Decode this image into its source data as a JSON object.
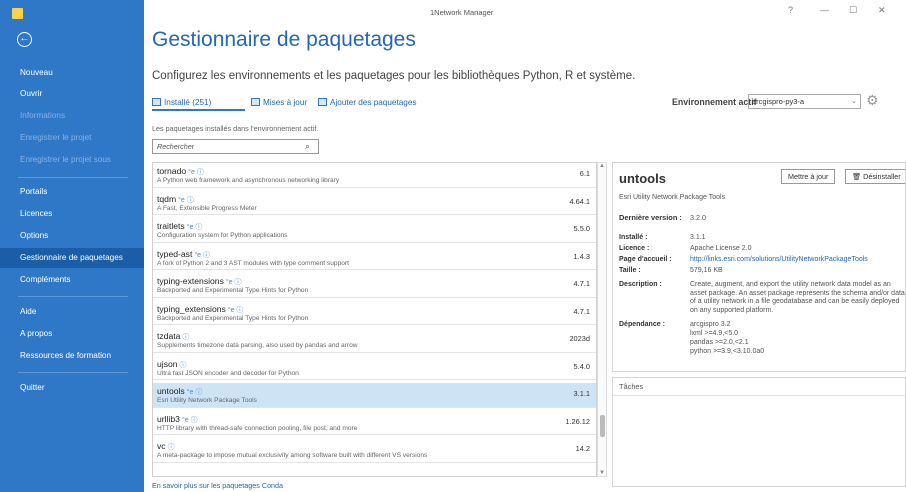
{
  "window": {
    "title": "1Network Manager",
    "controls": [
      "?",
      "—",
      "☐",
      "✕"
    ]
  },
  "sidebar": {
    "back_icon": "back-arrow-icon",
    "items": [
      {
        "label": "Nouveau",
        "state": "normal"
      },
      {
        "label": "Ouvrir",
        "state": "normal"
      },
      {
        "label": "Informations",
        "state": "disabled"
      },
      {
        "label": "Enregistrer le projet",
        "state": "disabled"
      },
      {
        "label": "Enregistrer le projet sous",
        "state": "disabled"
      },
      {
        "label": "Portails",
        "state": "normal"
      },
      {
        "label": "Licences",
        "state": "normal"
      },
      {
        "label": "Options",
        "state": "normal"
      },
      {
        "label": "Gestionnaire de paquetages",
        "state": "active"
      },
      {
        "label": "Compléments",
        "state": "normal"
      },
      {
        "label": "Aide",
        "state": "normal"
      },
      {
        "label": "A propos",
        "state": "normal"
      },
      {
        "label": "Ressources de formation",
        "state": "normal"
      },
      {
        "label": "Quitter",
        "state": "normal"
      }
    ]
  },
  "header": {
    "title": "Gestionnaire de paquetages",
    "subtitle": "Configurez les environnements et les paquetages pour les bibliothèques Python, R et système."
  },
  "tabs": [
    {
      "label": "Installé (251)",
      "active": true
    },
    {
      "label": "Mises à jour",
      "active": false
    },
    {
      "label": "Ajouter des paquetages",
      "active": false
    }
  ],
  "environment": {
    "label": "Environnement actif",
    "value": "arcgispro-py3-a"
  },
  "installed_note": "Les paquetages installés dans l'environnement actif.",
  "search": {
    "placeholder": "Rechercher"
  },
  "packages": [
    {
      "name": "tornado",
      "badge": "°e ⓘ",
      "description": "A Python web framework and asynchronous networking library",
      "version": "6.1"
    },
    {
      "name": "tqdm",
      "badge": "°e ⓘ",
      "description": "A Fast, Extensible Progress Meter",
      "version": "4.64.1"
    },
    {
      "name": "traitlets",
      "badge": "°e ⓘ",
      "description": "Configuration system for Python applications",
      "version": "5.5.0"
    },
    {
      "name": "typed-ast",
      "badge": "°e ⓘ",
      "description": "A fork of Python 2 and 3 AST modules with type comment support",
      "version": "1.4.3"
    },
    {
      "name": "typing-extensions",
      "badge": "°e ⓘ",
      "description": "Backported and Experimental Type Hints for Python",
      "version": "4.7.1"
    },
    {
      "name": "typing_extensions",
      "badge": "°e ⓘ",
      "description": "Backported and Experimental Type Hints for Python",
      "version": "4.7.1"
    },
    {
      "name": "tzdata",
      "badge": "ⓘ",
      "description": "Supplements timezone data parsing, also used by pandas and arrow",
      "version": "2023d"
    },
    {
      "name": "ujson",
      "badge": "ⓘ",
      "description": "Ultra fast JSON encoder and decoder for Python",
      "version": "5.4.0"
    },
    {
      "name": "untools",
      "badge": "°e ⓘ",
      "description": "Esri Utility Network Package Tools",
      "version": "3.1.1",
      "selected": true
    },
    {
      "name": "urllib3",
      "badge": "°e ⓘ",
      "description": "HTTP library with thread-safe connection pooling, file post, and more",
      "version": "1.26.12"
    },
    {
      "name": "vc",
      "badge": "ⓘ",
      "description": "A meta-package to impose mutual exclusivity among software built with different VS versions",
      "version": "14.2"
    }
  ],
  "conda_link": "En savoir plus sur les paquetages Conda",
  "details": {
    "title": "untools",
    "update_button": "Mettre à jour",
    "uninstall_button": "Désinstaller",
    "subtitle": "Esri Utility Network Package Tools",
    "latest_label": "Dernière version :",
    "latest_value": "3.2.0",
    "installed_label": "Installé :",
    "installed_value": "3.1.1",
    "license_label": "Licence :",
    "license_value": "Apache License 2.0",
    "homepage_label": "Page d'accueil :",
    "homepage_value": "http://links.esri.com/solutions/UtilityNetworkPackageTools",
    "size_label": "Taille :",
    "size_value": "579,16 KB",
    "description_label": "Description :",
    "description_value": "Create, augment, and export the utility network data model as an asset package. An asset package represents the schema and/or data of a utility network in a file geodatabase and can be easily deployed on any supported platform.",
    "dependency_label": "Dépendance :",
    "dependencies": [
      "arcgispro 3.2",
      "lxml >=4.9,<5.0",
      "pandas >=2.0,<2.1",
      "python >=3.9,<3.10.0a0"
    ]
  },
  "tasks": {
    "label": "Tâches"
  }
}
